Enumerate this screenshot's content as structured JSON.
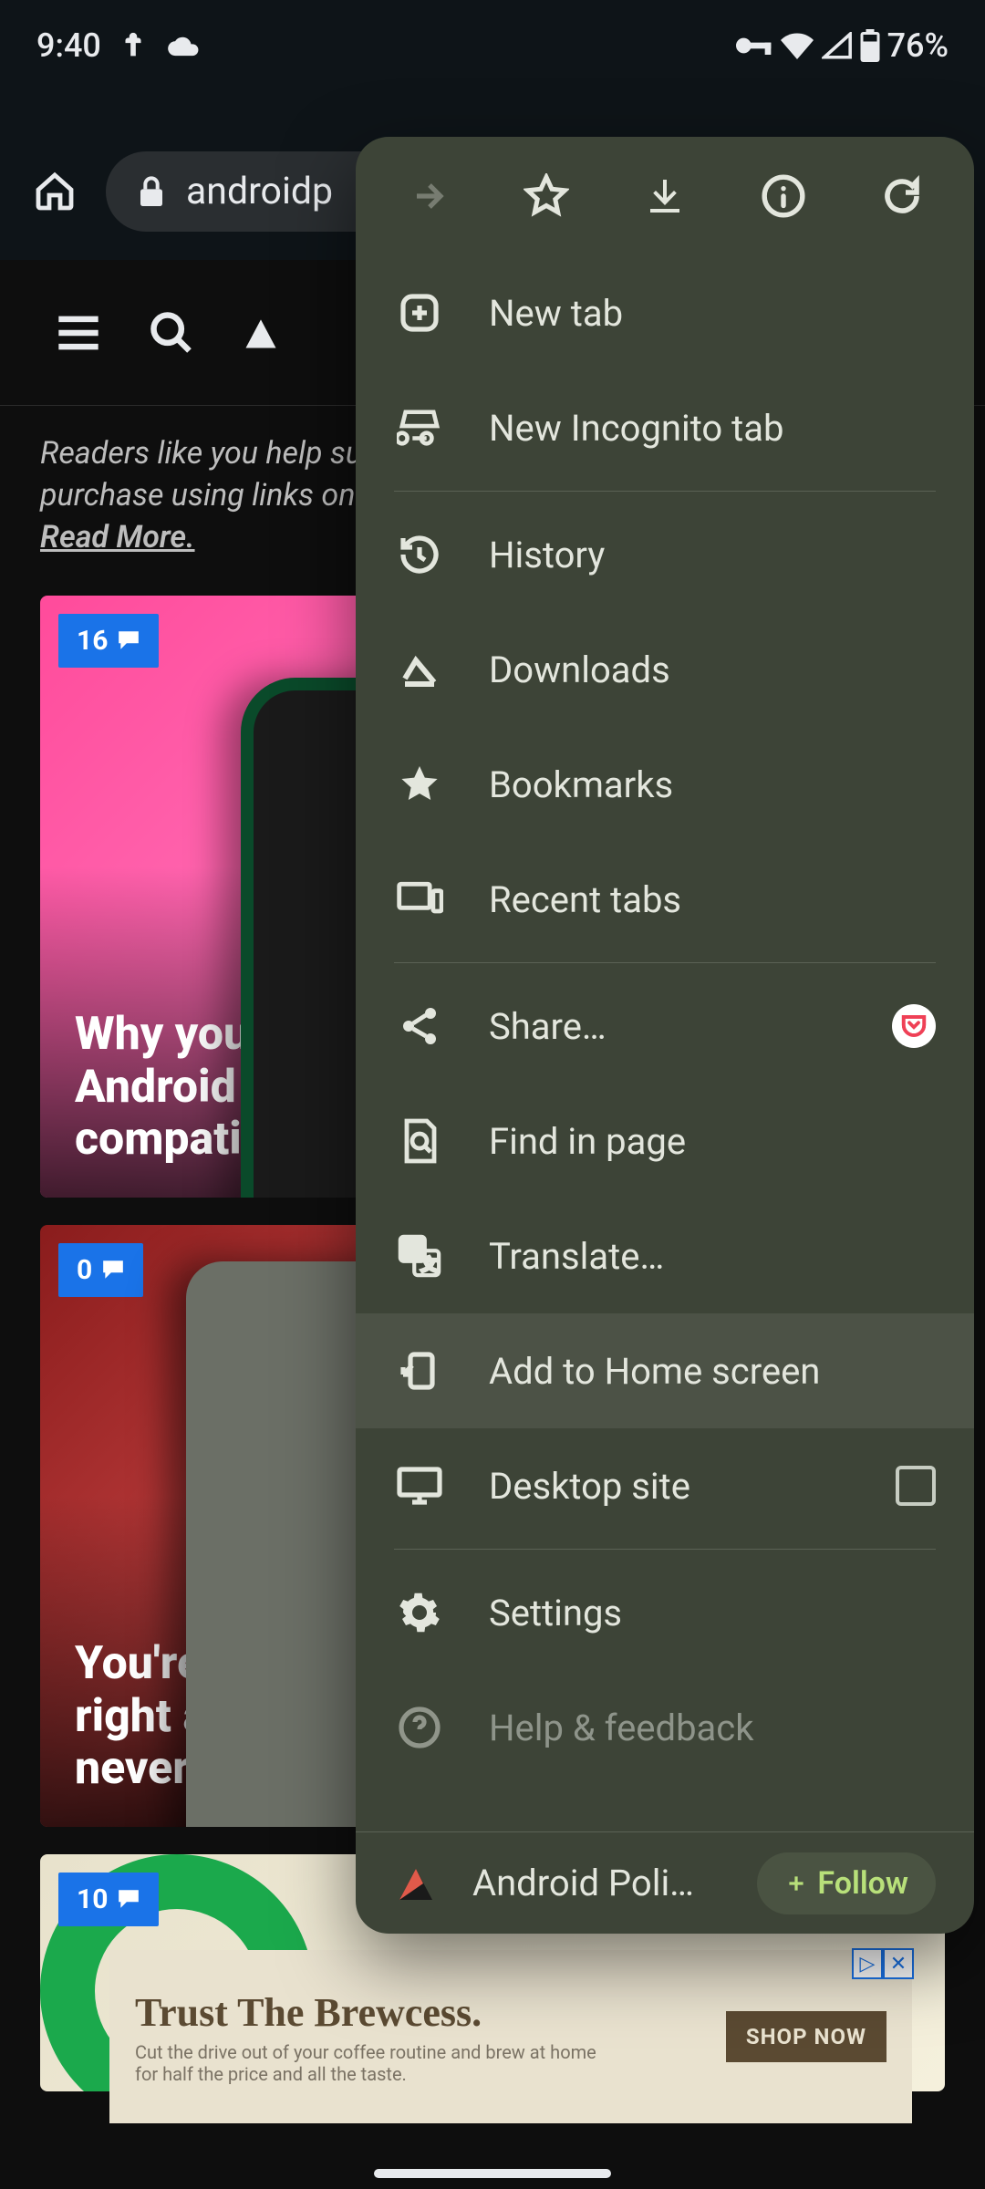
{
  "status": {
    "time": "9:40",
    "battery_pct": "76%"
  },
  "chrome": {
    "url_text": "androidp"
  },
  "page": {
    "disclaimer_line1": "Readers like you help su",
    "disclaimer_line2": "purchase using links on ",
    "read_more": "Read More.",
    "cards": [
      {
        "comments": "16",
        "title": "Why you sho\nAndroid befo\ncompatible"
      },
      {
        "comments": "0",
        "title": "You're not ho\nright and the\nnever will"
      },
      {
        "comments": "10",
        "title": ""
      }
    ]
  },
  "ad": {
    "title": "Trust The Brewcess.",
    "subtitle": "Cut the drive out of your coffee routine and brew at home for half the price and all the taste.",
    "cta": "SHOP NOW"
  },
  "menu": {
    "items": {
      "new_tab": "New tab",
      "incognito": "New Incognito tab",
      "history": "History",
      "downloads": "Downloads",
      "bookmarks": "Bookmarks",
      "recent_tabs": "Recent tabs",
      "share": "Share…",
      "find": "Find in page",
      "translate": "Translate…",
      "add_home": "Add to Home screen",
      "desktop": "Desktop site",
      "settings": "Settings",
      "help": "Help & feedback"
    },
    "site_name": "Android Poli…",
    "follow": "Follow"
  }
}
